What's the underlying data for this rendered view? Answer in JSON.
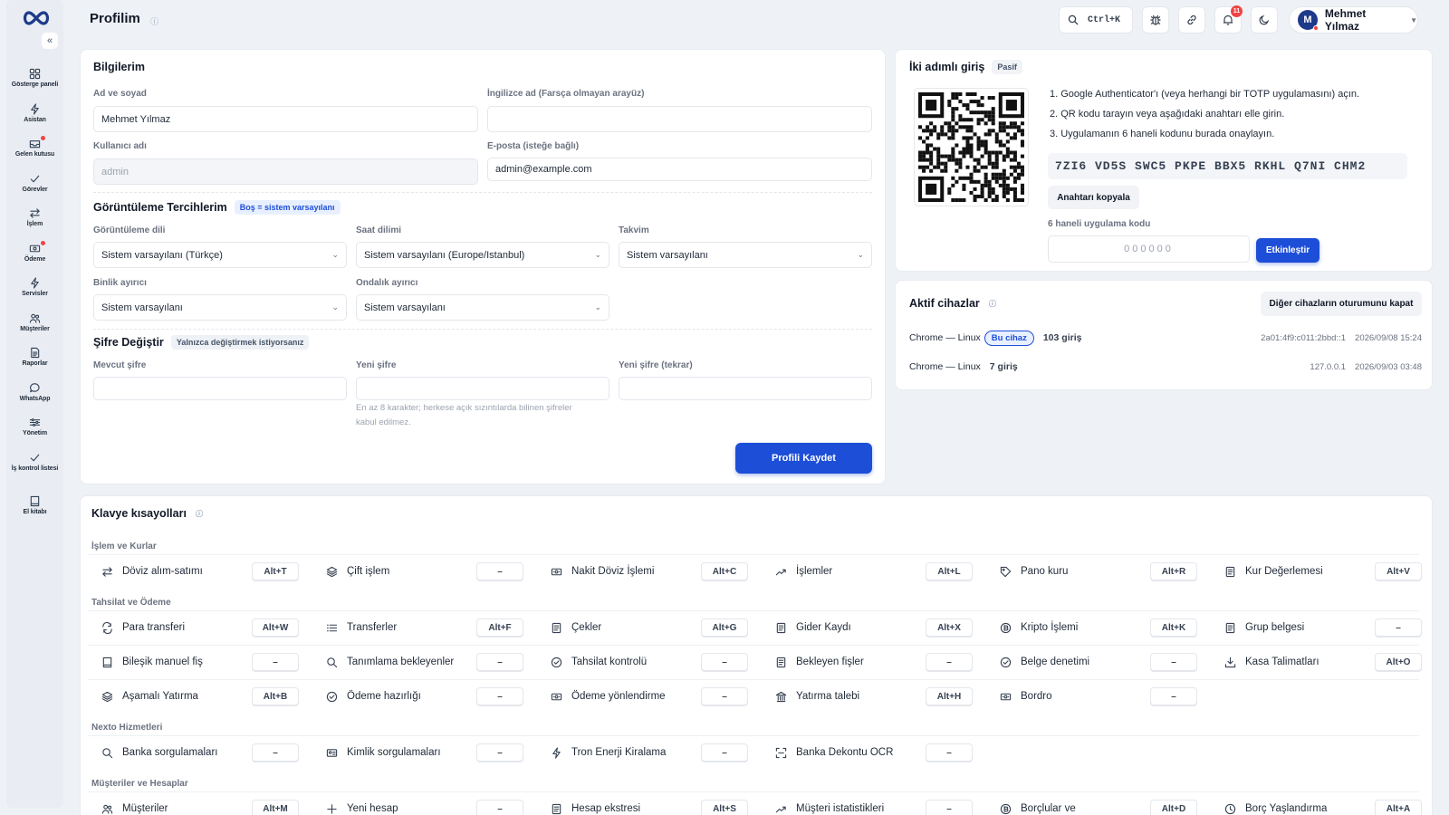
{
  "header": {
    "title": "Profilim",
    "search_hint": "Ctrl+K",
    "notif_count": "11",
    "user_initial": "M",
    "user_name": "Mehmet Yılmaz"
  },
  "sidebar": {
    "items": [
      {
        "label": "Gösterge paneli",
        "icon": "dashboard-icon"
      },
      {
        "label": "Asistan",
        "icon": "bolt-icon"
      },
      {
        "label": "Gelen kutusu",
        "icon": "inbox-icon"
      },
      {
        "label": "Görevler",
        "icon": "check-icon"
      },
      {
        "label": "İşlem",
        "icon": "swap-icon"
      },
      {
        "label": "Ödeme",
        "icon": "payment-icon"
      },
      {
        "label": "Servisler",
        "icon": "bolt-icon"
      },
      {
        "label": "Müşteriler",
        "icon": "users-icon"
      },
      {
        "label": "Raporlar",
        "icon": "report-icon"
      },
      {
        "label": "WhatsApp",
        "icon": "chat-icon"
      },
      {
        "label": "Yönetim",
        "icon": "sliders-icon"
      },
      {
        "label": "İş kontrol listesi",
        "icon": "check-icon"
      },
      {
        "label": "El kitabı",
        "icon": "book-icon"
      }
    ]
  },
  "profile": {
    "title": "Bilgilerim",
    "fullname_label": "Ad ve soyad",
    "fullname_value": "Mehmet Yılmaz",
    "english_label": "İngilizce ad (Farsça olmayan arayüz)",
    "english_value": "",
    "username_label": "Kullanıcı adı",
    "username_value": "admin",
    "email_label": "E-posta (isteğe bağlı)",
    "email_value": "admin@example.com",
    "prefs_title": "Görüntüleme Tercihlerim",
    "prefs_badge": "Boş = sistem varsayılanı",
    "lang_label": "Görüntüleme dili",
    "lang_value": "Sistem varsayılanı (Türkçe)",
    "tz_label": "Saat dilimi",
    "tz_value": "Sistem varsayılanı (Europe/Istanbul)",
    "cal_label": "Takvim",
    "cal_value": "Sistem varsayılanı",
    "thousand_label": "Binlik ayırıcı",
    "thousand_value": "Sistem varsayılanı",
    "decimal_label": "Ondalık ayırıcı",
    "decimal_value": "Sistem varsayılanı",
    "pw_title": "Şifre Değiştir",
    "pw_badge": "Yalnızca değiştirmek istiyorsanız",
    "current_pw_label": "Mevcut şifre",
    "new_pw_label": "Yeni şifre",
    "new_pw2_label": "Yeni şifre (tekrar)",
    "pw_hint_1": "En az 8 karakter; herkese açık sızıntılarda bilinen şifreler",
    "pw_hint_2": "kabul edilmez.",
    "save_label": "Profili Kaydet"
  },
  "twofa": {
    "title": "İki adımlı giriş",
    "status": "Pasif",
    "step1": "1. Google Authenticator'ı (veya herhangi bir TOTP uygulamasını) açın.",
    "step2": "2. QR kodu tarayın veya aşağıdaki anahtarı elle girin.",
    "step3": "3. Uygulamanın 6 haneli kodunu burada onaylayın.",
    "secret": "7ZI6 VD5S SWC5 PKPE BBX5 RKHL Q7NI CHM2",
    "copy_label": "Anahtarı kopyala",
    "code_label": "6 haneli uygulama kodu",
    "code_placeholder": "000000",
    "activate_label": "Etkinleştir"
  },
  "devices": {
    "title": "Aktif cihazlar",
    "logout_label": "Diğer cihazların oturumunu kapat",
    "rows": [
      {
        "name": "Chrome — Linux",
        "badge": "Bu cihaz",
        "logins": "103 giriş",
        "ip": "2a01:4f9:c011:2bbd::1",
        "time": "2026/09/08 15:24"
      },
      {
        "name": "Chrome — Linux",
        "badge": "",
        "logins": "7 giriş",
        "ip": "127.0.0.1",
        "time": "2026/09/03 03:48"
      }
    ]
  },
  "shortcuts": {
    "title": "Klavye kısayolları",
    "categories": [
      {
        "name": "İşlem ve Kurlar",
        "rows": [
          [
            {
              "label": "Döviz alım-satımı",
              "key": "Alt+T",
              "icon": "swap-icon"
            },
            {
              "label": "Çift işlem",
              "key": "–",
              "icon": "layers-icon"
            },
            {
              "label": "Nakit Döviz İşlemi",
              "key": "Alt+C",
              "icon": "cash-icon"
            },
            {
              "label": "İşlemler",
              "key": "Alt+L",
              "icon": "trend-icon"
            },
            {
              "label": "Pano kuru",
              "key": "Alt+R",
              "icon": "tag-icon"
            },
            {
              "label": "Kur Değerlemesi",
              "key": "Alt+V",
              "icon": "doc-icon"
            }
          ]
        ]
      },
      {
        "name": "Tahsilat ve Ödeme",
        "rows": [
          [
            {
              "label": "Para transferi",
              "key": "Alt+W",
              "icon": "transfer-icon"
            },
            {
              "label": "Transferler",
              "key": "Alt+F",
              "icon": "list-icon"
            },
            {
              "label": "Çekler",
              "key": "Alt+G",
              "icon": "doc-icon"
            },
            {
              "label": "Gider Kaydı",
              "key": "Alt+X",
              "icon": "doc-icon"
            },
            {
              "label": "Kripto İşlemi",
              "key": "Alt+K",
              "icon": "crypto-icon"
            },
            {
              "label": "Grup belgesi",
              "key": "–",
              "icon": "doc-icon"
            }
          ],
          [
            {
              "label": "Bileşik manuel fiş",
              "key": "–",
              "icon": "book-icon"
            },
            {
              "label": "Tanımlama bekleyenler",
              "key": "–",
              "icon": "search-icon"
            },
            {
              "label": "Tahsilat kontrolü",
              "key": "–",
              "icon": "checkcircle-icon"
            },
            {
              "label": "Bekleyen fişler",
              "key": "–",
              "icon": "doc-icon"
            },
            {
              "label": "Belge denetimi",
              "key": "–",
              "icon": "checkcircle-icon"
            },
            {
              "label": "Kasa Talimatları",
              "key": "Alt+O",
              "icon": "download-icon"
            }
          ],
          [
            {
              "label": "Aşamalı Yatırma",
              "key": "Alt+B",
              "icon": "layers-icon"
            },
            {
              "label": "Ödeme hazırlığı",
              "key": "–",
              "icon": "checkcircle-icon"
            },
            {
              "label": "Ödeme yönlendirme",
              "key": "–",
              "icon": "cash-icon"
            },
            {
              "label": "Yatırma talebi",
              "key": "Alt+H",
              "icon": "bank-icon"
            },
            {
              "label": "Bordro",
              "key": "–",
              "icon": "cash-icon"
            }
          ]
        ]
      },
      {
        "name": "Nexto Hizmetleri",
        "rows": [
          [
            {
              "label": "Banka sorgulamaları",
              "key": "–",
              "icon": "search-icon"
            },
            {
              "label": "Kimlik sorgulamaları",
              "key": "–",
              "icon": "idcard-icon"
            },
            {
              "label": "Tron Enerji Kiralama",
              "key": "–",
              "icon": "bolt-icon"
            },
            {
              "label": "Banka Dekontu OCR",
              "key": "–",
              "icon": "scan-icon"
            }
          ]
        ]
      },
      {
        "name": "Müşteriler ve Hesaplar",
        "rows": [
          [
            {
              "label": "Müşteriler",
              "key": "Alt+M",
              "icon": "users-icon"
            },
            {
              "label": "Yeni hesap",
              "key": "–",
              "icon": "plus-icon"
            },
            {
              "label": "Hesap ekstresi",
              "key": "Alt+S",
              "icon": "doc-icon"
            },
            {
              "label": "Müşteri istatistikleri",
              "key": "–",
              "icon": "trend-icon"
            },
            {
              "label": "Borçlular ve",
              "key": "Alt+D",
              "icon": "crypto-icon"
            },
            {
              "label": "Borç Yaşlandırma",
              "key": "Alt+A",
              "icon": "clock-icon"
            }
          ]
        ]
      }
    ]
  }
}
